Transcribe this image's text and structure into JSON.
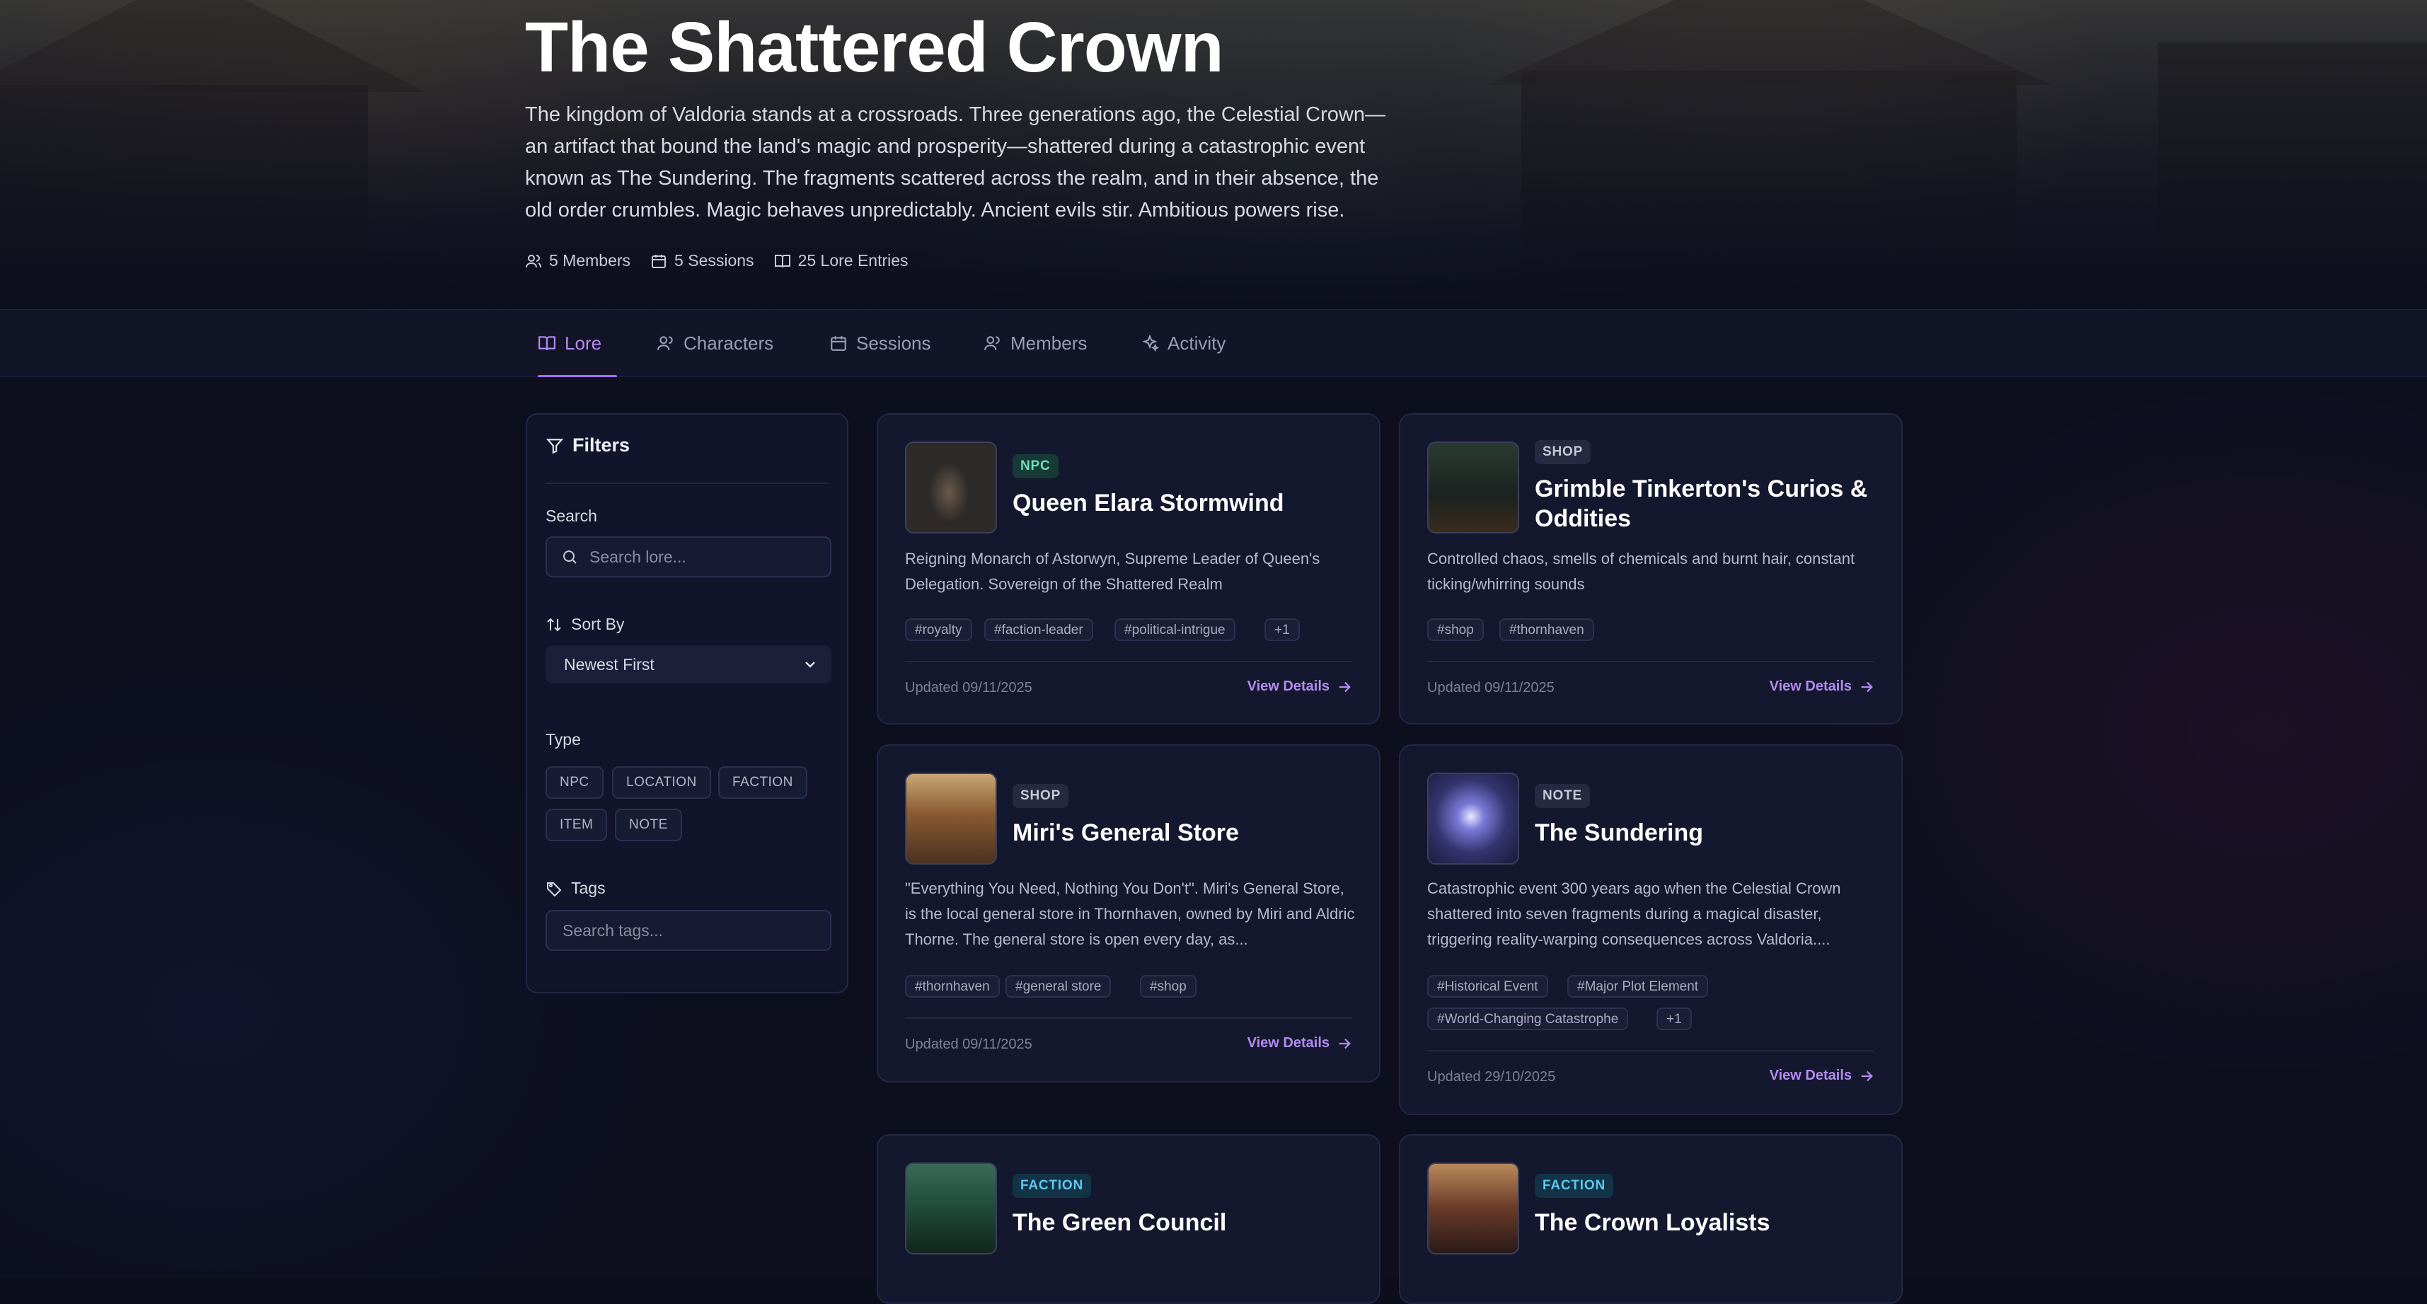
{
  "campaign": {
    "title": "The Shattered Crown",
    "description": "The kingdom of Valdoria stands at a crossroads. Three generations ago, the Celestial Crown—an artifact that bound the land's magic and prosperity—shattered during a catastrophic event known as The Sundering. The fragments scattered across the realm, and in their absence, the old order crumbles. Magic behaves unpredictably. Ancient evils stir. Ambitious powers rise.",
    "stats": {
      "members": "5 Members",
      "sessions": "5 Sessions",
      "lore": "25 Lore Entries"
    }
  },
  "tabs": [
    {
      "label": "Lore",
      "icon": "book-icon",
      "active": true
    },
    {
      "label": "Characters",
      "icon": "users-icon"
    },
    {
      "label": "Sessions",
      "icon": "calendar-icon"
    },
    {
      "label": "Members",
      "icon": "users-icon"
    },
    {
      "label": "Activity",
      "icon": "sparkles-icon"
    }
  ],
  "filters": {
    "heading": "Filters",
    "search_label": "Search",
    "search_placeholder": "Search lore...",
    "sort_label": "Sort By",
    "sort_value": "Newest First",
    "type_label": "Type",
    "types": [
      "NPC",
      "LOCATION",
      "FACTION",
      "ITEM",
      "NOTE"
    ],
    "tags_label": "Tags",
    "tags_placeholder": "Search tags..."
  },
  "cards": [
    {
      "type": "NPC",
      "title": "Queen Elara Stormwind",
      "description": "Reigning Monarch of Astorwyn, Supreme Leader of Queen's Delegation. Sovereign of the Shattered Realm",
      "tags": [
        "#royalty",
        "#faction-leader",
        "#political-intrigue",
        "+1"
      ],
      "updated": "Updated 09/11/2025",
      "link": "View Details"
    },
    {
      "type": "SHOP",
      "title": "Grimble Tinkerton's Curios & Oddities",
      "description": "Controlled chaos, smells of chemicals and burnt hair, constant ticking/whirring sounds",
      "tags": [
        "#shop",
        "#thornhaven"
      ],
      "updated": "Updated 09/11/2025",
      "link": "View Details"
    },
    {
      "type": "SHOP",
      "title": "Miri's General Store",
      "description": "\"Everything You Need, Nothing You Don't\". Miri's General Store, is the local general store in Thornhaven, owned by Miri and Aldric Thorne. The general store is open every day, as...",
      "tags": [
        "#thornhaven",
        "#general store",
        "#shop"
      ],
      "updated": "Updated 09/11/2025",
      "link": "View Details"
    },
    {
      "type": "NOTE",
      "title": "The Sundering",
      "description": "Catastrophic event 300 years ago when the Celestial Crown shattered into seven fragments during a magical disaster, triggering reality-warping consequences across Valdoria....",
      "tags": [
        "#Historical Event",
        "#Major Plot Element",
        "#World-Changing Catastrophe",
        "+1"
      ],
      "updated": "Updated 29/10/2025",
      "link": "View Details"
    },
    {
      "type": "FACTION",
      "title": "The Green Council"
    },
    {
      "type": "FACTION",
      "title": "The Crown Loyalists"
    }
  ]
}
